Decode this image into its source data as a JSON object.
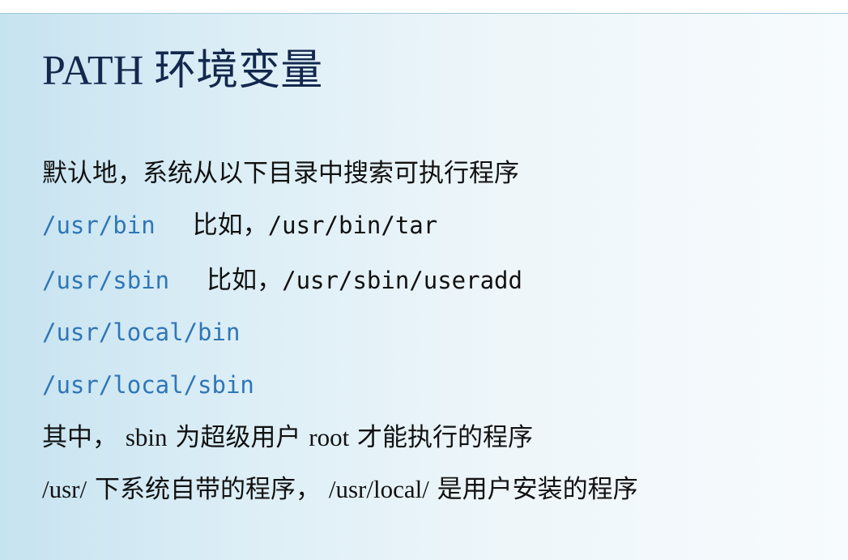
{
  "slide": {
    "title": "PATH 环境变量",
    "intro": "默认地，系统从以下目录中搜索可执行程序",
    "paths": [
      {
        "dir": "/usr/bin",
        "example_label": "比如，",
        "example": "/usr/bin/tar"
      },
      {
        "dir": "/usr/sbin",
        "example_label": "比如，",
        "example": "/usr/sbin/useradd"
      },
      {
        "dir": "/usr/local/bin"
      },
      {
        "dir": "/usr/local/sbin"
      }
    ],
    "note1": {
      "prefix": "其中， ",
      "sbin": "sbin",
      "mid": " 为超级用户 ",
      "root": "root",
      "suffix": " 才能执行的程序"
    },
    "note2": {
      "usr": "/usr/",
      "mid": " 下系统自带的程序， ",
      "usr_local": "/usr/local/",
      "suffix": " 是用户安装的程序"
    }
  }
}
